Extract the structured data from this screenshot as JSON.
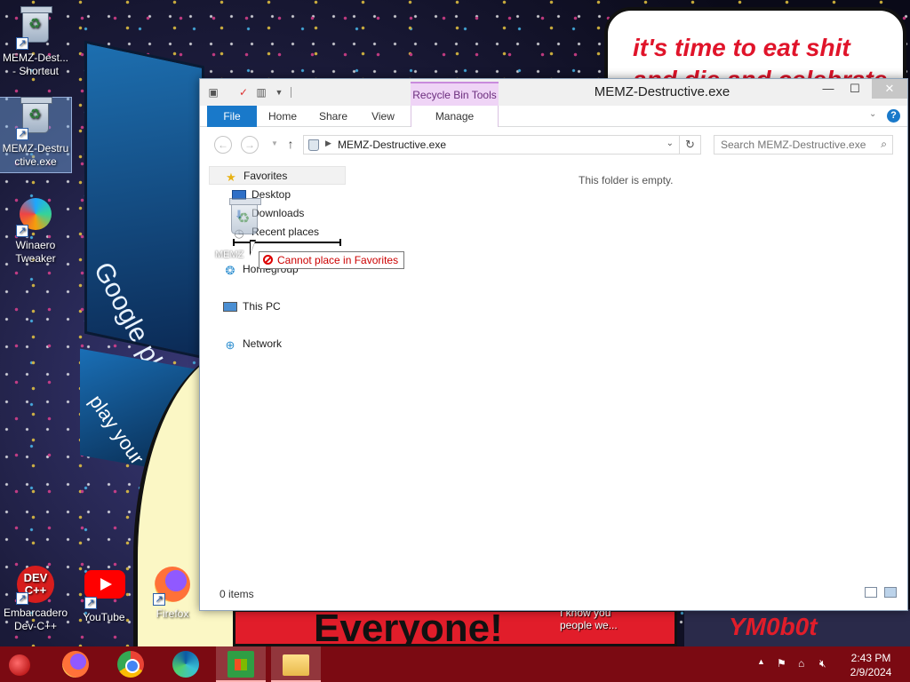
{
  "wallpaper": {
    "bubble_line1": "it's time to eat shit",
    "bubble_line2": "and die and celebrate",
    "billboard": "Google play",
    "billboard2": "play your",
    "banner": "Everyone!",
    "caption": "I know you\npeople we...",
    "corner": "YM0b0t"
  },
  "desktop_icons": [
    {
      "label": "MEMZ-Dest...\n- Shortcut",
      "icon": "recycle-bin-icon",
      "shortcut": true
    },
    {
      "label": "MEMZ-Destru\nctive.exe",
      "icon": "recycle-bin-icon",
      "shortcut": true
    },
    {
      "label": "Winaero\nTweaker",
      "icon": "winaero-icon",
      "shortcut": true
    },
    {
      "label": "Embarcadero\nDev-C++",
      "icon": "devcpp-icon",
      "glyph_text": "DEV\nC++",
      "shortcut": true
    },
    {
      "label": "YouTube",
      "icon": "youtube-icon",
      "shortcut": true
    },
    {
      "label": "Firefox",
      "icon": "firefox-icon",
      "shortcut": true
    }
  ],
  "window": {
    "title": "MEMZ-Destructive.exe",
    "context_tab_group": "Recycle Bin Tools",
    "ribbon_tabs": [
      "File",
      "Home",
      "Share",
      "View",
      "Manage"
    ],
    "minimize": "—",
    "maximize": "☐",
    "close": "✕",
    "help": "?",
    "address": {
      "crumb": "MEMZ-Destructive.exe"
    },
    "search": {
      "placeholder": "Search MEMZ-Destructive.exe"
    },
    "nav": {
      "favorites": "Favorites",
      "desktop": "Desktop",
      "downloads": "Downloads",
      "recent": "Recent places",
      "homegroup": "Homegroup",
      "this_pc": "This PC",
      "network": "Network"
    },
    "empty_message": "This folder is empty.",
    "status": "0 items"
  },
  "drag": {
    "ghost_label": "MEMZ",
    "tooltip": "Cannot place in Favorites"
  },
  "taskbar": {
    "apps": [
      "start-orb-icon",
      "firefox-icon",
      "chrome-icon",
      "edge-icon",
      "store-icon",
      "file-explorer-icon"
    ],
    "time": "2:43 PM",
    "date": "2/9/2024"
  },
  "colors": {
    "taskbar": "#7b0a12",
    "file_tab": "#1979ca",
    "context_tab": "#efd4f6",
    "error_text": "#cc0000"
  }
}
